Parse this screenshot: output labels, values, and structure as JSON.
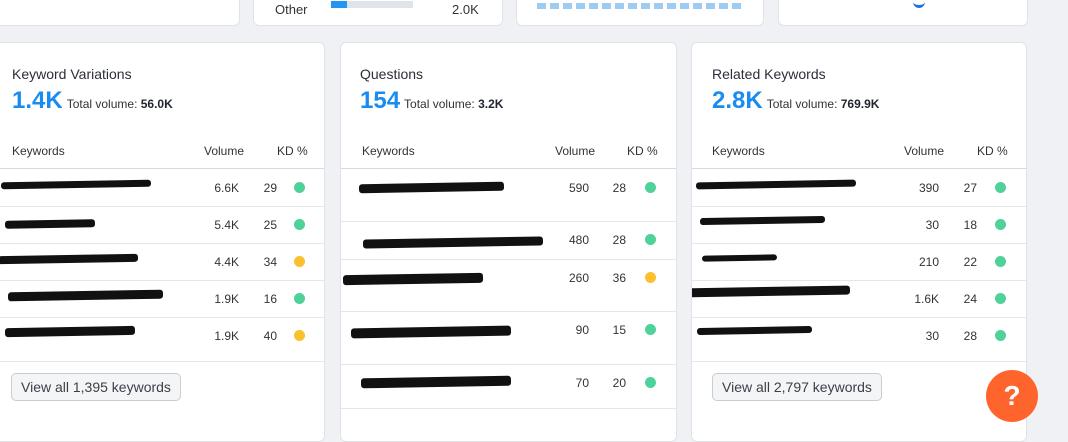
{
  "top": {
    "other_label": "Other",
    "other_value": "2.0K",
    "other_share_pct": 20
  },
  "panels": [
    {
      "title": "Keyword Variations",
      "count": "1.4K",
      "total_label": "Total volume:",
      "total_value": "56.0K",
      "headers": {
        "keyword": "Keywords",
        "volume": "Volume",
        "kd": "KD %"
      },
      "rows": [
        {
          "volume": "6.6K",
          "kd": "29",
          "kd_color": "#4fd19a"
        },
        {
          "volume": "5.4K",
          "kd": "25",
          "kd_color": "#4fd19a"
        },
        {
          "volume": "4.4K",
          "kd": "34",
          "kd_color": "#fbc02d"
        },
        {
          "volume": "1.9K",
          "kd": "16",
          "kd_color": "#4fd19a"
        },
        {
          "volume": "1.9K",
          "kd": "40",
          "kd_color": "#fbc02d"
        }
      ],
      "button": "View all 1,395 keywords"
    },
    {
      "title": "Questions",
      "count": "154",
      "total_label": "Total volume:",
      "total_value": "3.2K",
      "headers": {
        "keyword": "Keywords",
        "volume": "Volume",
        "kd": "KD %"
      },
      "rows": [
        {
          "volume": "590",
          "kd": "28",
          "kd_color": "#4fd19a"
        },
        {
          "volume": "480",
          "kd": "28",
          "kd_color": "#4fd19a"
        },
        {
          "volume": "260",
          "kd": "36",
          "kd_color": "#fbc02d"
        },
        {
          "volume": "90",
          "kd": "15",
          "kd_color": "#4fd19a"
        },
        {
          "volume": "70",
          "kd": "20",
          "kd_color": "#4fd19a"
        }
      ]
    },
    {
      "title": "Related Keywords",
      "count": "2.8K",
      "total_label": "Total volume:",
      "total_value": "769.9K",
      "headers": {
        "keyword": "Keywords",
        "volume": "Volume",
        "kd": "KD %"
      },
      "rows": [
        {
          "volume": "390",
          "kd": "27",
          "kd_color": "#4fd19a"
        },
        {
          "volume": "30",
          "kd": "18",
          "kd_color": "#4fd19a"
        },
        {
          "volume": "210",
          "kd": "22",
          "kd_color": "#4fd19a"
        },
        {
          "volume": "1.6K",
          "kd": "24",
          "kd_color": "#4fd19a"
        },
        {
          "volume": "30",
          "kd": "28",
          "kd_color": "#4fd19a"
        }
      ],
      "button": "View all 2,797 keywords"
    }
  ],
  "help": {
    "label": "?"
  },
  "colors": {
    "accent": "#1a8cf0",
    "help": "#ff642d"
  }
}
